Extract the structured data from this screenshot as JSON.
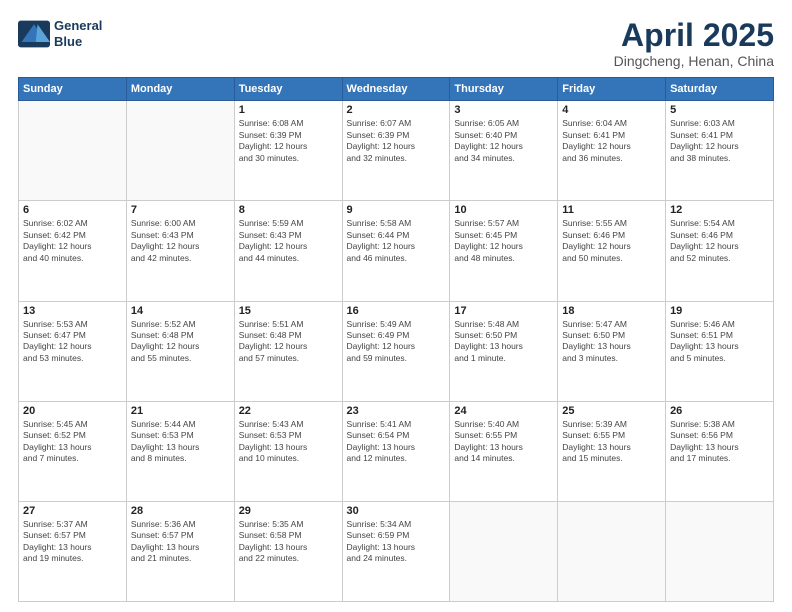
{
  "logo": {
    "line1": "General",
    "line2": "Blue"
  },
  "title": "April 2025",
  "subtitle": "Dingcheng, Henan, China",
  "weekdays": [
    "Sunday",
    "Monday",
    "Tuesday",
    "Wednesday",
    "Thursday",
    "Friday",
    "Saturday"
  ],
  "weeks": [
    [
      {
        "day": "",
        "info": ""
      },
      {
        "day": "",
        "info": ""
      },
      {
        "day": "1",
        "info": "Sunrise: 6:08 AM\nSunset: 6:39 PM\nDaylight: 12 hours\nand 30 minutes."
      },
      {
        "day": "2",
        "info": "Sunrise: 6:07 AM\nSunset: 6:39 PM\nDaylight: 12 hours\nand 32 minutes."
      },
      {
        "day": "3",
        "info": "Sunrise: 6:05 AM\nSunset: 6:40 PM\nDaylight: 12 hours\nand 34 minutes."
      },
      {
        "day": "4",
        "info": "Sunrise: 6:04 AM\nSunset: 6:41 PM\nDaylight: 12 hours\nand 36 minutes."
      },
      {
        "day": "5",
        "info": "Sunrise: 6:03 AM\nSunset: 6:41 PM\nDaylight: 12 hours\nand 38 minutes."
      }
    ],
    [
      {
        "day": "6",
        "info": "Sunrise: 6:02 AM\nSunset: 6:42 PM\nDaylight: 12 hours\nand 40 minutes."
      },
      {
        "day": "7",
        "info": "Sunrise: 6:00 AM\nSunset: 6:43 PM\nDaylight: 12 hours\nand 42 minutes."
      },
      {
        "day": "8",
        "info": "Sunrise: 5:59 AM\nSunset: 6:43 PM\nDaylight: 12 hours\nand 44 minutes."
      },
      {
        "day": "9",
        "info": "Sunrise: 5:58 AM\nSunset: 6:44 PM\nDaylight: 12 hours\nand 46 minutes."
      },
      {
        "day": "10",
        "info": "Sunrise: 5:57 AM\nSunset: 6:45 PM\nDaylight: 12 hours\nand 48 minutes."
      },
      {
        "day": "11",
        "info": "Sunrise: 5:55 AM\nSunset: 6:46 PM\nDaylight: 12 hours\nand 50 minutes."
      },
      {
        "day": "12",
        "info": "Sunrise: 5:54 AM\nSunset: 6:46 PM\nDaylight: 12 hours\nand 52 minutes."
      }
    ],
    [
      {
        "day": "13",
        "info": "Sunrise: 5:53 AM\nSunset: 6:47 PM\nDaylight: 12 hours\nand 53 minutes."
      },
      {
        "day": "14",
        "info": "Sunrise: 5:52 AM\nSunset: 6:48 PM\nDaylight: 12 hours\nand 55 minutes."
      },
      {
        "day": "15",
        "info": "Sunrise: 5:51 AM\nSunset: 6:48 PM\nDaylight: 12 hours\nand 57 minutes."
      },
      {
        "day": "16",
        "info": "Sunrise: 5:49 AM\nSunset: 6:49 PM\nDaylight: 12 hours\nand 59 minutes."
      },
      {
        "day": "17",
        "info": "Sunrise: 5:48 AM\nSunset: 6:50 PM\nDaylight: 13 hours\nand 1 minute."
      },
      {
        "day": "18",
        "info": "Sunrise: 5:47 AM\nSunset: 6:50 PM\nDaylight: 13 hours\nand 3 minutes."
      },
      {
        "day": "19",
        "info": "Sunrise: 5:46 AM\nSunset: 6:51 PM\nDaylight: 13 hours\nand 5 minutes."
      }
    ],
    [
      {
        "day": "20",
        "info": "Sunrise: 5:45 AM\nSunset: 6:52 PM\nDaylight: 13 hours\nand 7 minutes."
      },
      {
        "day": "21",
        "info": "Sunrise: 5:44 AM\nSunset: 6:53 PM\nDaylight: 13 hours\nand 8 minutes."
      },
      {
        "day": "22",
        "info": "Sunrise: 5:43 AM\nSunset: 6:53 PM\nDaylight: 13 hours\nand 10 minutes."
      },
      {
        "day": "23",
        "info": "Sunrise: 5:41 AM\nSunset: 6:54 PM\nDaylight: 13 hours\nand 12 minutes."
      },
      {
        "day": "24",
        "info": "Sunrise: 5:40 AM\nSunset: 6:55 PM\nDaylight: 13 hours\nand 14 minutes."
      },
      {
        "day": "25",
        "info": "Sunrise: 5:39 AM\nSunset: 6:55 PM\nDaylight: 13 hours\nand 15 minutes."
      },
      {
        "day": "26",
        "info": "Sunrise: 5:38 AM\nSunset: 6:56 PM\nDaylight: 13 hours\nand 17 minutes."
      }
    ],
    [
      {
        "day": "27",
        "info": "Sunrise: 5:37 AM\nSunset: 6:57 PM\nDaylight: 13 hours\nand 19 minutes."
      },
      {
        "day": "28",
        "info": "Sunrise: 5:36 AM\nSunset: 6:57 PM\nDaylight: 13 hours\nand 21 minutes."
      },
      {
        "day": "29",
        "info": "Sunrise: 5:35 AM\nSunset: 6:58 PM\nDaylight: 13 hours\nand 22 minutes."
      },
      {
        "day": "30",
        "info": "Sunrise: 5:34 AM\nSunset: 6:59 PM\nDaylight: 13 hours\nand 24 minutes."
      },
      {
        "day": "",
        "info": ""
      },
      {
        "day": "",
        "info": ""
      },
      {
        "day": "",
        "info": ""
      }
    ]
  ]
}
